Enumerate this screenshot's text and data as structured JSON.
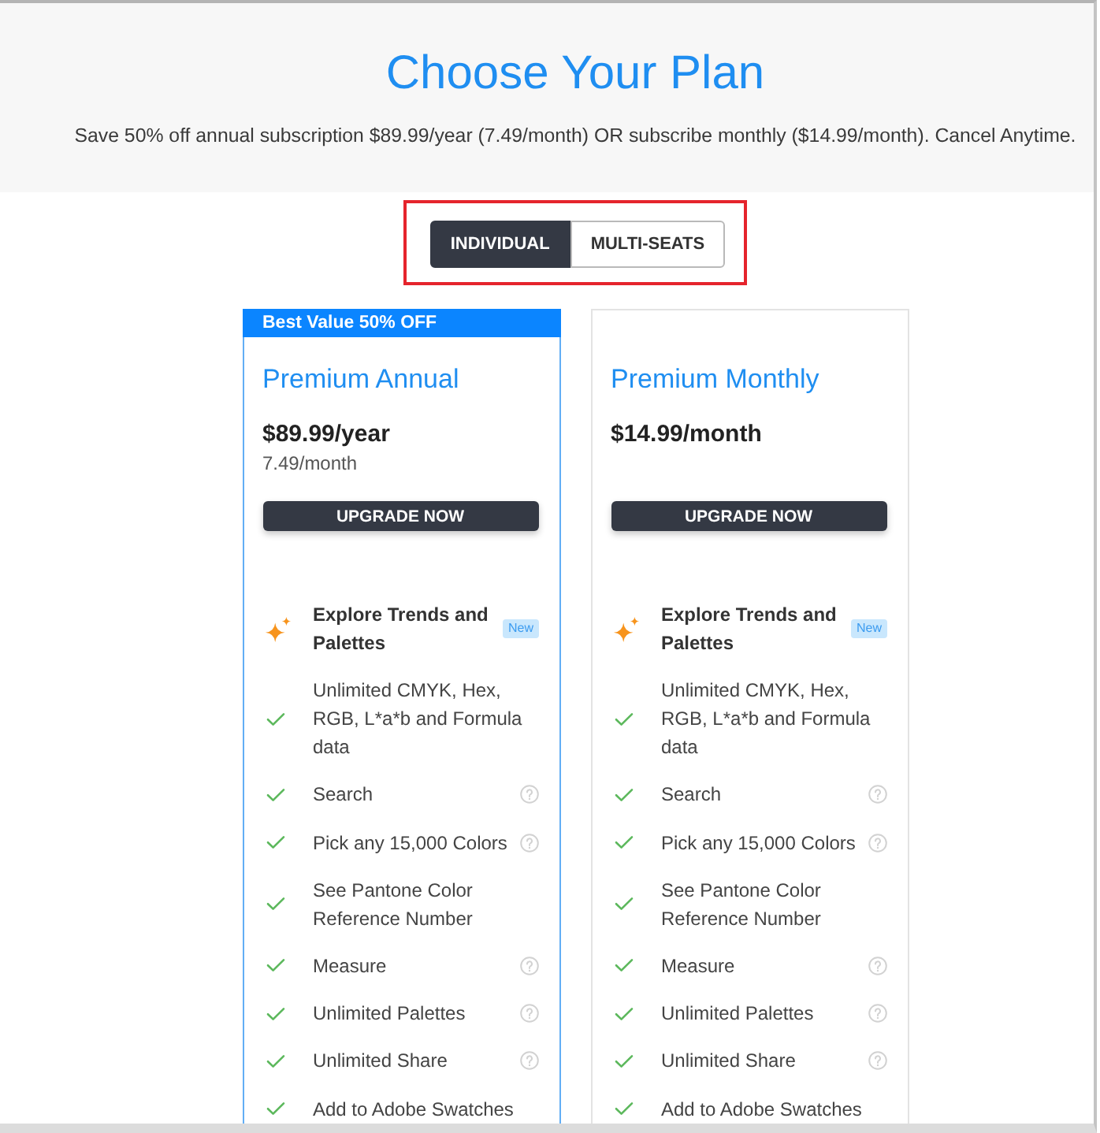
{
  "header": {
    "title": "Choose Your Plan",
    "subtitle": "Save 50% off annual subscription $89.99/year (7.49/month) OR subscribe monthly ($14.99/month). Cancel Anytime."
  },
  "plan_toggle": {
    "highlighted": true,
    "tabs": [
      {
        "label": "INDIVIDUAL",
        "selected": true
      },
      {
        "label": "MULTI-SEATS",
        "selected": false
      }
    ]
  },
  "plans": [
    {
      "ribbon": "Best Value 50% OFF",
      "featured": true,
      "name": "Premium Annual",
      "price": "$89.99/year",
      "price_note": "7.49/month",
      "button": "UPGRADE NOW",
      "features": [
        {
          "kind": "highlight",
          "label": "Explore Trends and Palettes",
          "badge": "New",
          "help": false
        },
        {
          "kind": "included",
          "label": "Unlimited CMYK, Hex, RGB, L*a*b and Formula data",
          "help": false
        },
        {
          "kind": "included",
          "label": "Search",
          "help": true
        },
        {
          "kind": "included",
          "label": "Pick any 15,000 Colors",
          "help": true
        },
        {
          "kind": "included",
          "label": "See Pantone Color Reference Number",
          "help": false
        },
        {
          "kind": "included",
          "label": "Measure",
          "help": true
        },
        {
          "kind": "included",
          "label": "Unlimited Palettes",
          "help": true
        },
        {
          "kind": "included",
          "label": "Unlimited Share",
          "help": true
        },
        {
          "kind": "included",
          "label": "Add to Adobe Swatches",
          "help": false
        }
      ]
    },
    {
      "featured": false,
      "name": "Premium Monthly",
      "price": "$14.99/month",
      "button": "UPGRADE NOW",
      "features": [
        {
          "kind": "highlight",
          "label": "Explore Trends and Palettes",
          "badge": "New",
          "help": false
        },
        {
          "kind": "included",
          "label": "Unlimited CMYK, Hex, RGB, L*a*b and Formula data",
          "help": false
        },
        {
          "kind": "included",
          "label": "Search",
          "help": true
        },
        {
          "kind": "included",
          "label": "Pick any 15,000 Colors",
          "help": true
        },
        {
          "kind": "included",
          "label": "See Pantone Color Reference Number",
          "help": false
        },
        {
          "kind": "included",
          "label": "Measure",
          "help": true
        },
        {
          "kind": "included",
          "label": "Unlimited Palettes",
          "help": true
        },
        {
          "kind": "included",
          "label": "Unlimited Share",
          "help": true
        },
        {
          "kind": "included",
          "label": "Add to Adobe Swatches",
          "help": false
        }
      ]
    }
  ]
}
